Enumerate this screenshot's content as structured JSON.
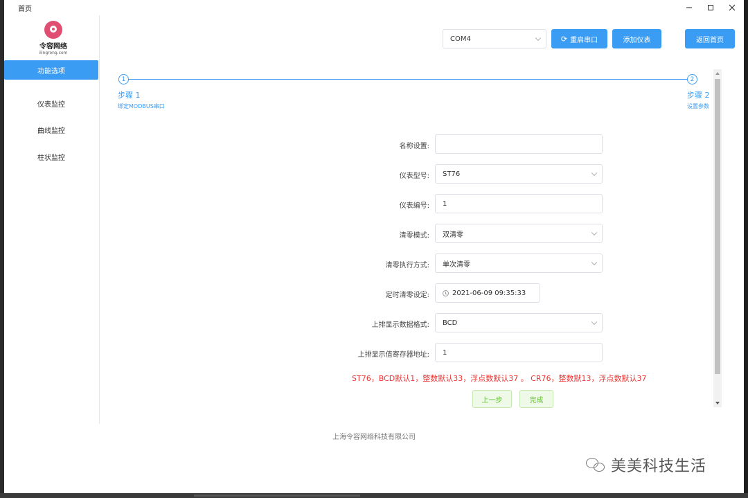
{
  "window": {
    "title": "首页"
  },
  "logo": {
    "name": "令容网络",
    "sub": "ilingrong.com"
  },
  "sidebar": {
    "items": [
      {
        "label": "功能选项"
      },
      {
        "label": "仪表监控"
      },
      {
        "label": "曲线监控"
      },
      {
        "label": "柱状监控"
      }
    ]
  },
  "toolbar": {
    "port_value": "COM4",
    "restart_label": "重启串口",
    "add_label": "添加仪表",
    "home_label": "返回首页"
  },
  "steps": [
    {
      "number": "1",
      "title": "步骤 1",
      "desc": "绑定MODBUS串口"
    },
    {
      "number": "2",
      "title": "步骤 2",
      "desc": "设置参数"
    }
  ],
  "form": {
    "name": {
      "label": "名称设置:",
      "value": ""
    },
    "model": {
      "label": "仪表型号:",
      "value": "ST76"
    },
    "number": {
      "label": "仪表编号:",
      "value": "1"
    },
    "zero_mode": {
      "label": "清零模式:",
      "value": "双清零"
    },
    "zero_exec": {
      "label": "清零执行方式:",
      "value": "单次清零"
    },
    "timer": {
      "label": "定时清零设定:",
      "value": "2021-06-09 09:35:33"
    },
    "top_format": {
      "label": "上排显示数据格式:",
      "value": "BCD"
    },
    "top_address": {
      "label": "上排显示值寄存器地址:",
      "value": "1"
    }
  },
  "hint": "ST76，BCD默认1，整数默认33，浮点数默认37 。 CR76，整数默13，浮点数默认37",
  "actions": {
    "prev_label": "上一步",
    "finish_label": "完成"
  },
  "footer": "上海令容网络科技有限公司",
  "watermark": "美美科技生活",
  "colors": {
    "primary": "#3a9cf3",
    "success": "#67c23a",
    "danger": "#e33333"
  }
}
